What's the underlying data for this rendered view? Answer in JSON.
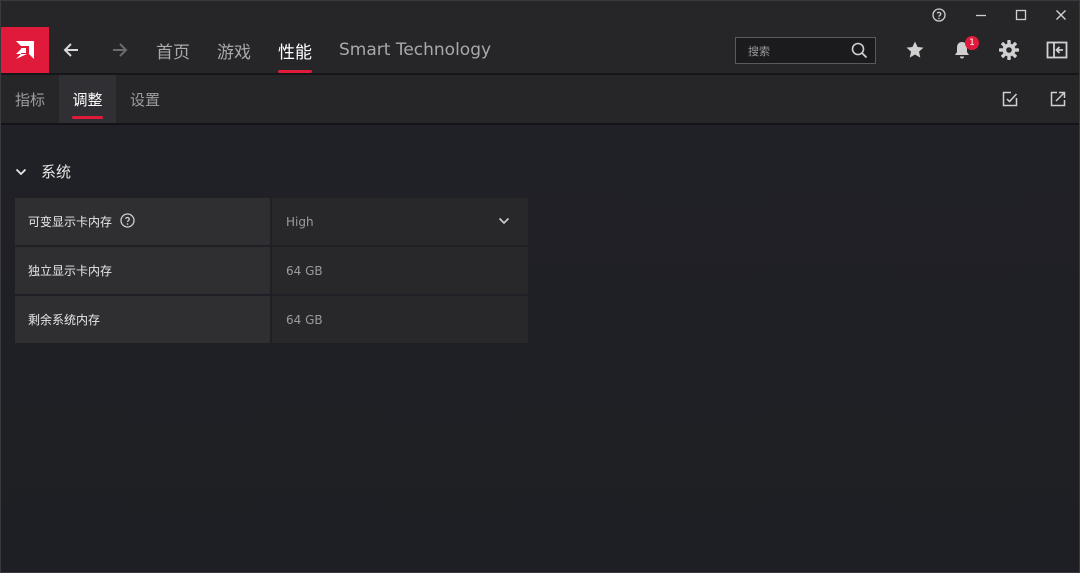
{
  "app": {
    "colors": {
      "accent": "#e01a3a",
      "background": "#1f2024",
      "bar": "#262629"
    }
  },
  "window_controls": {
    "help_icon": "help-circle-icon",
    "minimize_icon": "minimize-icon",
    "maximize_icon": "maximize-icon",
    "close_icon": "close-icon"
  },
  "topnav": {
    "logo_icon": "amd-logo-icon",
    "back_icon": "arrow-left-icon",
    "forward_icon": "arrow-right-icon",
    "items": [
      {
        "label": "首页",
        "active": false
      },
      {
        "label": "游戏",
        "active": false
      },
      {
        "label": "性能",
        "active": true
      },
      {
        "label": "Smart Technology",
        "active": false
      }
    ],
    "search": {
      "placeholder": "搜索",
      "value": ""
    },
    "notification_count": "1"
  },
  "subnav": {
    "items": [
      {
        "label": "指标",
        "active": false
      },
      {
        "label": "调整",
        "active": true
      },
      {
        "label": "设置",
        "active": false
      }
    ]
  },
  "section": {
    "title": "系统",
    "rows": [
      {
        "label": "可变显示卡内存",
        "value": "High",
        "has_help": true,
        "dropdown": true
      },
      {
        "label": "独立显示卡内存",
        "value": "64 GB",
        "has_help": false,
        "dropdown": false
      },
      {
        "label": "剩余系统内存",
        "value": "64 GB",
        "has_help": false,
        "dropdown": false
      }
    ]
  }
}
